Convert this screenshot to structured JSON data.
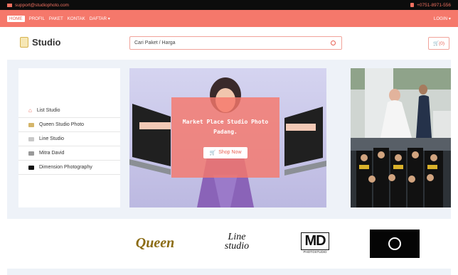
{
  "topbar": {
    "email": "support@studiophoto.com",
    "phone": "+0751-8971-556"
  },
  "nav": {
    "items": [
      "HOME",
      "PROFIL",
      "PAKET",
      "KONTAK",
      "DAFTAR"
    ],
    "login": "LOGIN"
  },
  "header": {
    "logo_text": "Studio",
    "search_placeholder": "Cari Paket / Harga",
    "cart_label": "(0)"
  },
  "sidebar": {
    "items": [
      {
        "label": "List Studio",
        "icon": "home-icon"
      },
      {
        "label": "Queen Studio Photo",
        "icon": "queen-logo-icon"
      },
      {
        "label": "Line Studio",
        "icon": "line-logo-icon"
      },
      {
        "label": "Mitra David",
        "icon": "mitra-logo-icon"
      },
      {
        "label": "Dimension Photography",
        "icon": "camera-icon"
      }
    ]
  },
  "banner": {
    "title": "Market Place Studio Photo Padang.",
    "button": "Shop Now"
  },
  "brands": {
    "queen": "Queen",
    "line": "Line studio",
    "md": "MD",
    "md_sub": "PHOTOSTUDIO"
  },
  "colors": {
    "accent": "#f5786b",
    "topbar_bg": "#0c0c0c",
    "hero_bg": "#eef2f8"
  }
}
